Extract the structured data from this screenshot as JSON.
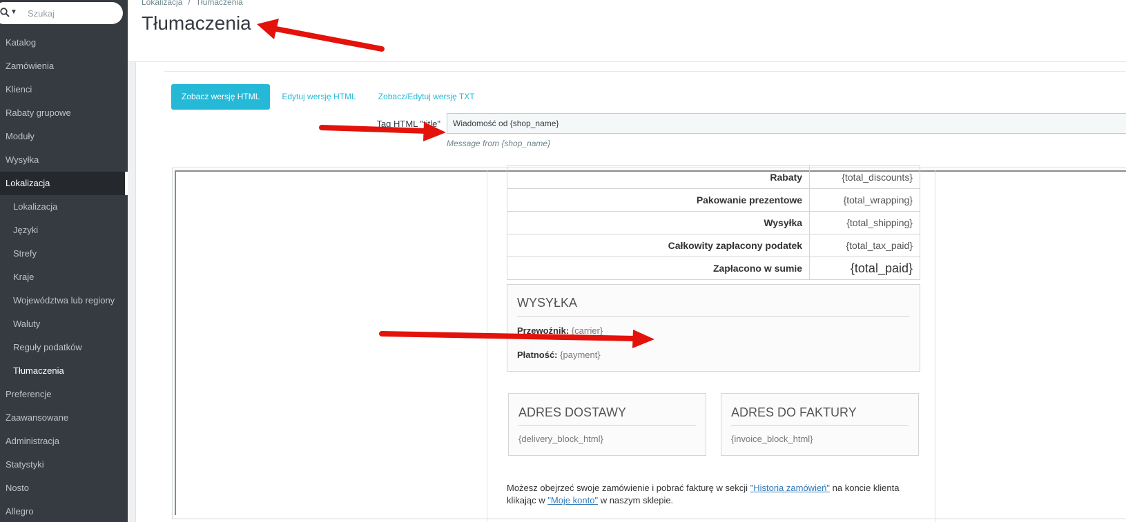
{
  "search": {
    "placeholder": "Szukaj"
  },
  "sidebar": {
    "items": [
      {
        "label": "Katalog"
      },
      {
        "label": "Zamówienia"
      },
      {
        "label": "Klienci"
      },
      {
        "label": "Rabaty grupowe"
      },
      {
        "label": "Moduły"
      },
      {
        "label": "Wysyłka"
      },
      {
        "label": "Lokalizacja"
      },
      {
        "label": "Lokalizacja"
      },
      {
        "label": "Języki"
      },
      {
        "label": "Strefy"
      },
      {
        "label": "Kraje"
      },
      {
        "label": "Województwa lub regiony"
      },
      {
        "label": "Waluty"
      },
      {
        "label": "Reguły podatków"
      },
      {
        "label": "Tłumaczenia"
      },
      {
        "label": "Preferencje"
      },
      {
        "label": "Zaawansowane"
      },
      {
        "label": "Administracja"
      },
      {
        "label": "Statystyki"
      },
      {
        "label": "Nosto"
      },
      {
        "label": "Allegro"
      }
    ]
  },
  "header": {
    "breadcrumb": [
      "Lokalizacja",
      "/",
      "Tłumaczenia"
    ],
    "title": "Tłumaczenia"
  },
  "tabs": [
    {
      "label": "Zobacz wersję HTML"
    },
    {
      "label": "Edytuj wersję HTML"
    },
    {
      "label": "Zobacz/Edytuj wersję TXT"
    }
  ],
  "form": {
    "title_label": "Tag HTML \"title\"",
    "title_value": "Wiadomość od {shop_name}",
    "title_help": "Message from {shop_name}"
  },
  "email": {
    "totals": [
      {
        "label": "Rabaty",
        "value": "{total_discounts}"
      },
      {
        "label": "Pakowanie prezentowe",
        "value": "{total_wrapping}"
      },
      {
        "label": "Wysyłka",
        "value": "{total_shipping}"
      },
      {
        "label": "Całkowity zapłacony podatek",
        "value": "{total_tax_paid}"
      },
      {
        "label": "Zapłacono w sumie",
        "value": "{total_paid}"
      }
    ],
    "shipping": {
      "title": "WYSYŁKA",
      "carrier_label": "Przewoźnik:",
      "carrier_value": "{carrier}",
      "payment_label": "Płatność:",
      "payment_value": "{payment}"
    },
    "delivery": {
      "title": "ADRES DOSTAWY",
      "value": "{delivery_block_html}"
    },
    "invoice": {
      "title": "ADRES DO FAKTURY",
      "value": "{invoice_block_html}"
    },
    "footer": {
      "text1": "Możesz obejrzeć swoje zamówienie i pobrać fakturę w sekcji ",
      "link1": "\"Historia zamówień\"",
      "text2": " na koncie klienta klikając w ",
      "link2": "\"Moje konto\"",
      "text3": " w naszym sklepie."
    }
  },
  "colors": {
    "sidebar_bg": "#363a41",
    "accent": "#25b9d7",
    "arrow": "#e3120b"
  }
}
